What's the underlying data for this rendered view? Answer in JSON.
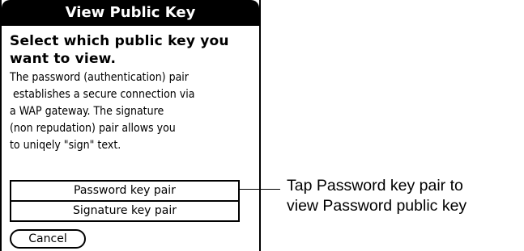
{
  "dialog": {
    "title": "View Public Key",
    "heading": [
      "Select which public key you",
      "want to view."
    ],
    "body_lines": [
      "The password (authentication) pair",
      " establishes a secure connection via",
      "a WAP gateway. The signature",
      "(non repudation) pair allows you",
      "to uniqely \"sign\" text."
    ],
    "key_options": [
      "Password key pair",
      "Signature key pair"
    ],
    "cancel_label": "Cancel"
  },
  "callout": {
    "lines": [
      "Tap Password key pair to",
      "view Password public key"
    ]
  }
}
